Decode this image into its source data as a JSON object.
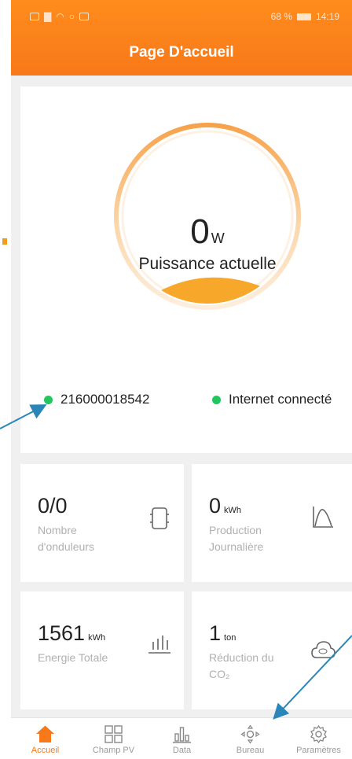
{
  "status_bar": {
    "battery": "68 %",
    "time": "14:19"
  },
  "header": {
    "title": "Page D'accueil"
  },
  "gauge": {
    "value": "0",
    "unit": "W",
    "label": "Puissance actuelle",
    "fill_fraction": 0
  },
  "status": {
    "device_id": "216000018542",
    "internet": "Internet connecté",
    "ok_color": "#22c55e"
  },
  "tiles": [
    {
      "value": "0/0",
      "unit": "",
      "label": "Nombre d'onduleurs",
      "icon": "inverter-icon"
    },
    {
      "value": "0",
      "unit": "kWh",
      "label": "Production Journalière",
      "icon": "curve-icon"
    },
    {
      "value": "1561",
      "unit": "kWh",
      "label": "Energie Totale",
      "icon": "bar-chart-icon"
    },
    {
      "value": "1",
      "unit": "ton",
      "label_main": "Réduction du",
      "label_sub": "CO₂",
      "icon": "co2-cloud-icon"
    }
  ],
  "nav": [
    {
      "label": "Accueil",
      "icon": "home-icon",
      "active": true
    },
    {
      "label": "Champ PV",
      "icon": "grid-icon",
      "active": false
    },
    {
      "label": "Data",
      "icon": "data-chart-icon",
      "active": false
    },
    {
      "label": "Bureau",
      "icon": "bureau-icon",
      "active": false
    },
    {
      "label": "Paramètres",
      "icon": "settings-icon",
      "active": false
    }
  ],
  "colors": {
    "accent": "#f7791a",
    "annotation": "#2a86b8"
  }
}
